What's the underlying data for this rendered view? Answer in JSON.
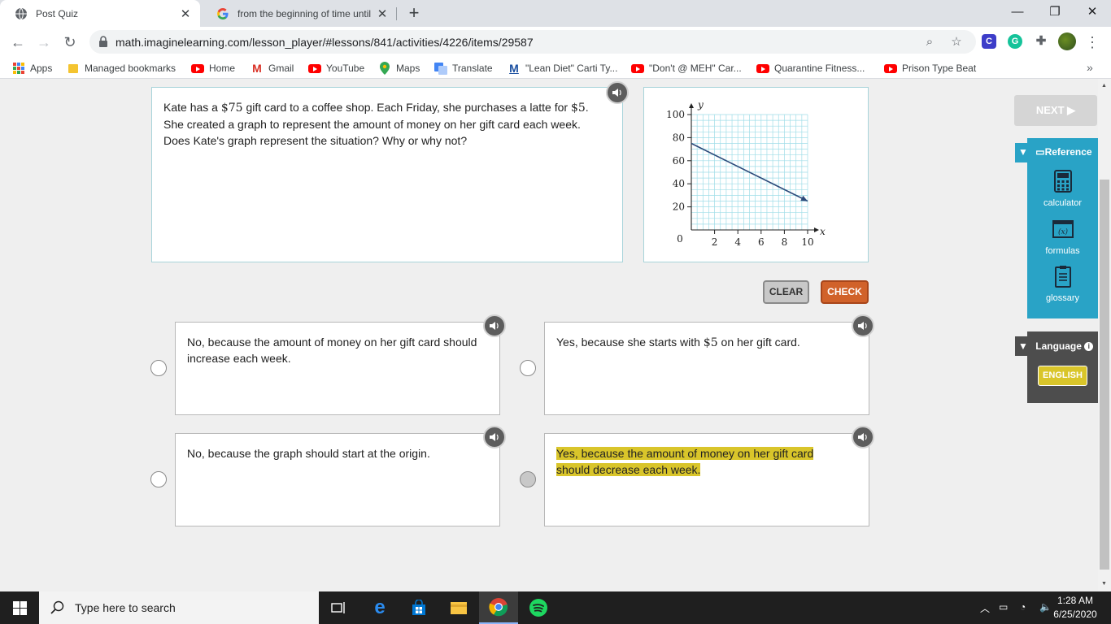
{
  "browser": {
    "tabs": [
      {
        "title": "Post Quiz",
        "active": true
      },
      {
        "title": "from the beginning of time until",
        "active": false
      }
    ],
    "url": "math.imaginelearning.com/lesson_player/#lessons/841/activities/4226/items/29587",
    "bookmarks": [
      {
        "label": "Apps",
        "icon": "apps-grid-icon"
      },
      {
        "label": "Managed bookmarks",
        "icon": "folder-icon"
      },
      {
        "label": "Home",
        "icon": "youtube-icon"
      },
      {
        "label": "Gmail",
        "icon": "gmail-icon"
      },
      {
        "label": "YouTube",
        "icon": "youtube-icon"
      },
      {
        "label": "Maps",
        "icon": "maps-icon"
      },
      {
        "label": "Translate",
        "icon": "translate-icon"
      },
      {
        "label": "\"Lean Diet\" Carti Ty...",
        "icon": "m-icon"
      },
      {
        "label": "\"Don't @ MEH\" Car...",
        "icon": "youtube-icon"
      },
      {
        "label": "Quarantine Fitness...",
        "icon": "youtube-icon"
      },
      {
        "label": "Prison Type Beat",
        "icon": "youtube-icon"
      }
    ]
  },
  "question": {
    "line1_pre": "Kate has a ",
    "amount1": "$75",
    "line1_mid": " gift card to a coffee shop. Each Friday, she purchases a latte for ",
    "amount2": "$5",
    "line1_end": ".",
    "line2": "She created a graph to represent the amount of money on her gift card each week.",
    "line3": "Does Kate's graph represent the situation? Why or why not?"
  },
  "chart_data": {
    "type": "line",
    "x": [
      0,
      10
    ],
    "y": [
      75,
      25
    ],
    "xlabel": "x",
    "ylabel": "y",
    "xlim": [
      0,
      10
    ],
    "ylim": [
      0,
      100
    ],
    "xticks": [
      "2",
      "4",
      "6",
      "8",
      "10"
    ],
    "yticks": [
      "20",
      "40",
      "60",
      "80",
      "100"
    ],
    "origin_label": "0",
    "grid": true
  },
  "buttons": {
    "clear": "CLEAR",
    "check": "CHECK",
    "next": "NEXT ▶"
  },
  "choices": [
    {
      "text": "No, because the amount of money on her gift card should increase each week.",
      "selected": false
    },
    {
      "text_pre": "Yes, because she starts with ",
      "amount": "$5",
      "text_post": " on her gift card.",
      "selected": false
    },
    {
      "text": "No, because the graph should start at the origin.",
      "selected": false
    },
    {
      "text": "Yes, because the amount of money on her gift card should decrease each week.",
      "selected": true
    }
  ],
  "sidebar": {
    "reference_title": "Reference",
    "items": [
      {
        "label": "calculator",
        "icon": "calculator-icon"
      },
      {
        "label": "formulas",
        "icon": "formulas-icon"
      },
      {
        "label": "glossary",
        "icon": "glossary-icon"
      }
    ],
    "language_title": "Language",
    "language_button": "ENGLISH"
  },
  "taskbar": {
    "search_placeholder": "Type here to search",
    "time": "1:28 AM",
    "date": "6/25/2020"
  },
  "colors": {
    "panel_border": "#a8d4da",
    "reference_panel": "#29a3c6",
    "highlight": "#d9c52a",
    "check_button": "#d1622a",
    "graph_grid": "#9fdde8",
    "graph_line": "#2c4a7a"
  }
}
